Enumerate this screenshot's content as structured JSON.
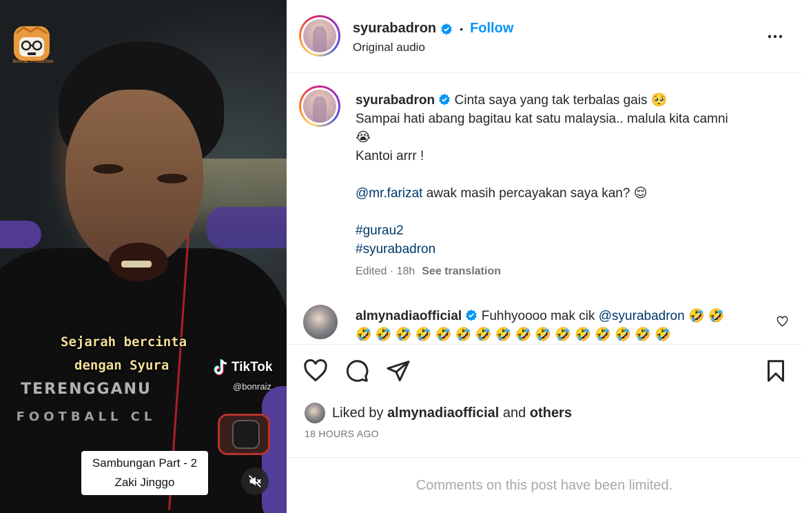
{
  "video": {
    "logo_caption": "Bonraiz Production",
    "overlay_line1": "Sejarah bercinta",
    "overlay_line2": "dengan Syura",
    "tiktok_label": "TikTok",
    "tiktok_handle": "@bonraiz",
    "shirt_line1": "TERENGGANU",
    "shirt_line2": "FOOTBALL CL",
    "part_label": "Sambungan Part - 2",
    "part_name": "Zaki Jinggo",
    "mute_icon": "muted-speaker-icon"
  },
  "header": {
    "username": "syurabadron",
    "verified_icon": "verified-badge-icon",
    "separator": "•",
    "follow_label": "Follow",
    "audio_label": "Original audio",
    "more_icon": "more-horizontal-icon"
  },
  "caption": {
    "username": "syurabadron",
    "line1": "Cinta saya yang tak terbalas gais",
    "emoji1": "🥺",
    "line2": "Sampai hati abang bagitau kat satu malaysia.. malula kita camni",
    "emoji2": "😭",
    "line3": "Kantoi arrr !",
    "mention": "@mr.farizat",
    "line4": "awak masih percayakan saya kan?",
    "emoji3": "😌",
    "hashtag1": "#gurau2",
    "hashtag2": "#syurabadron",
    "edited": "Edited · 18h",
    "see_translation": "See translation"
  },
  "comment": {
    "username": "almynadiaofficial",
    "text": "Fuhhyoooo mak cik",
    "mention": "@syurabadron",
    "emojis_inline": "🤣 🤣",
    "emojis_line": "🤣 🤣 🤣 🤣 🤣 🤣 🤣 🤣 🤣 🤣 🤣 🤣 🤣 🤣 🤣 🤣",
    "heart_icon": "heart-outline-icon"
  },
  "actions": {
    "like_icon": "heart-outline-icon",
    "comment_icon": "comment-bubble-icon",
    "share_icon": "paper-plane-icon",
    "save_icon": "bookmark-icon",
    "liked_by_prefix": "Liked by",
    "liked_by_user": "almynadiaofficial",
    "liked_by_and": "and",
    "liked_by_others": "others",
    "timestamp": "18 HOURS AGO"
  },
  "footer": {
    "limited_text": "Comments on this post have been limited."
  },
  "colors": {
    "accent": "#0095f6",
    "link": "#00376b",
    "muted": "#737373",
    "caption_yellow": "#f3df9a"
  }
}
